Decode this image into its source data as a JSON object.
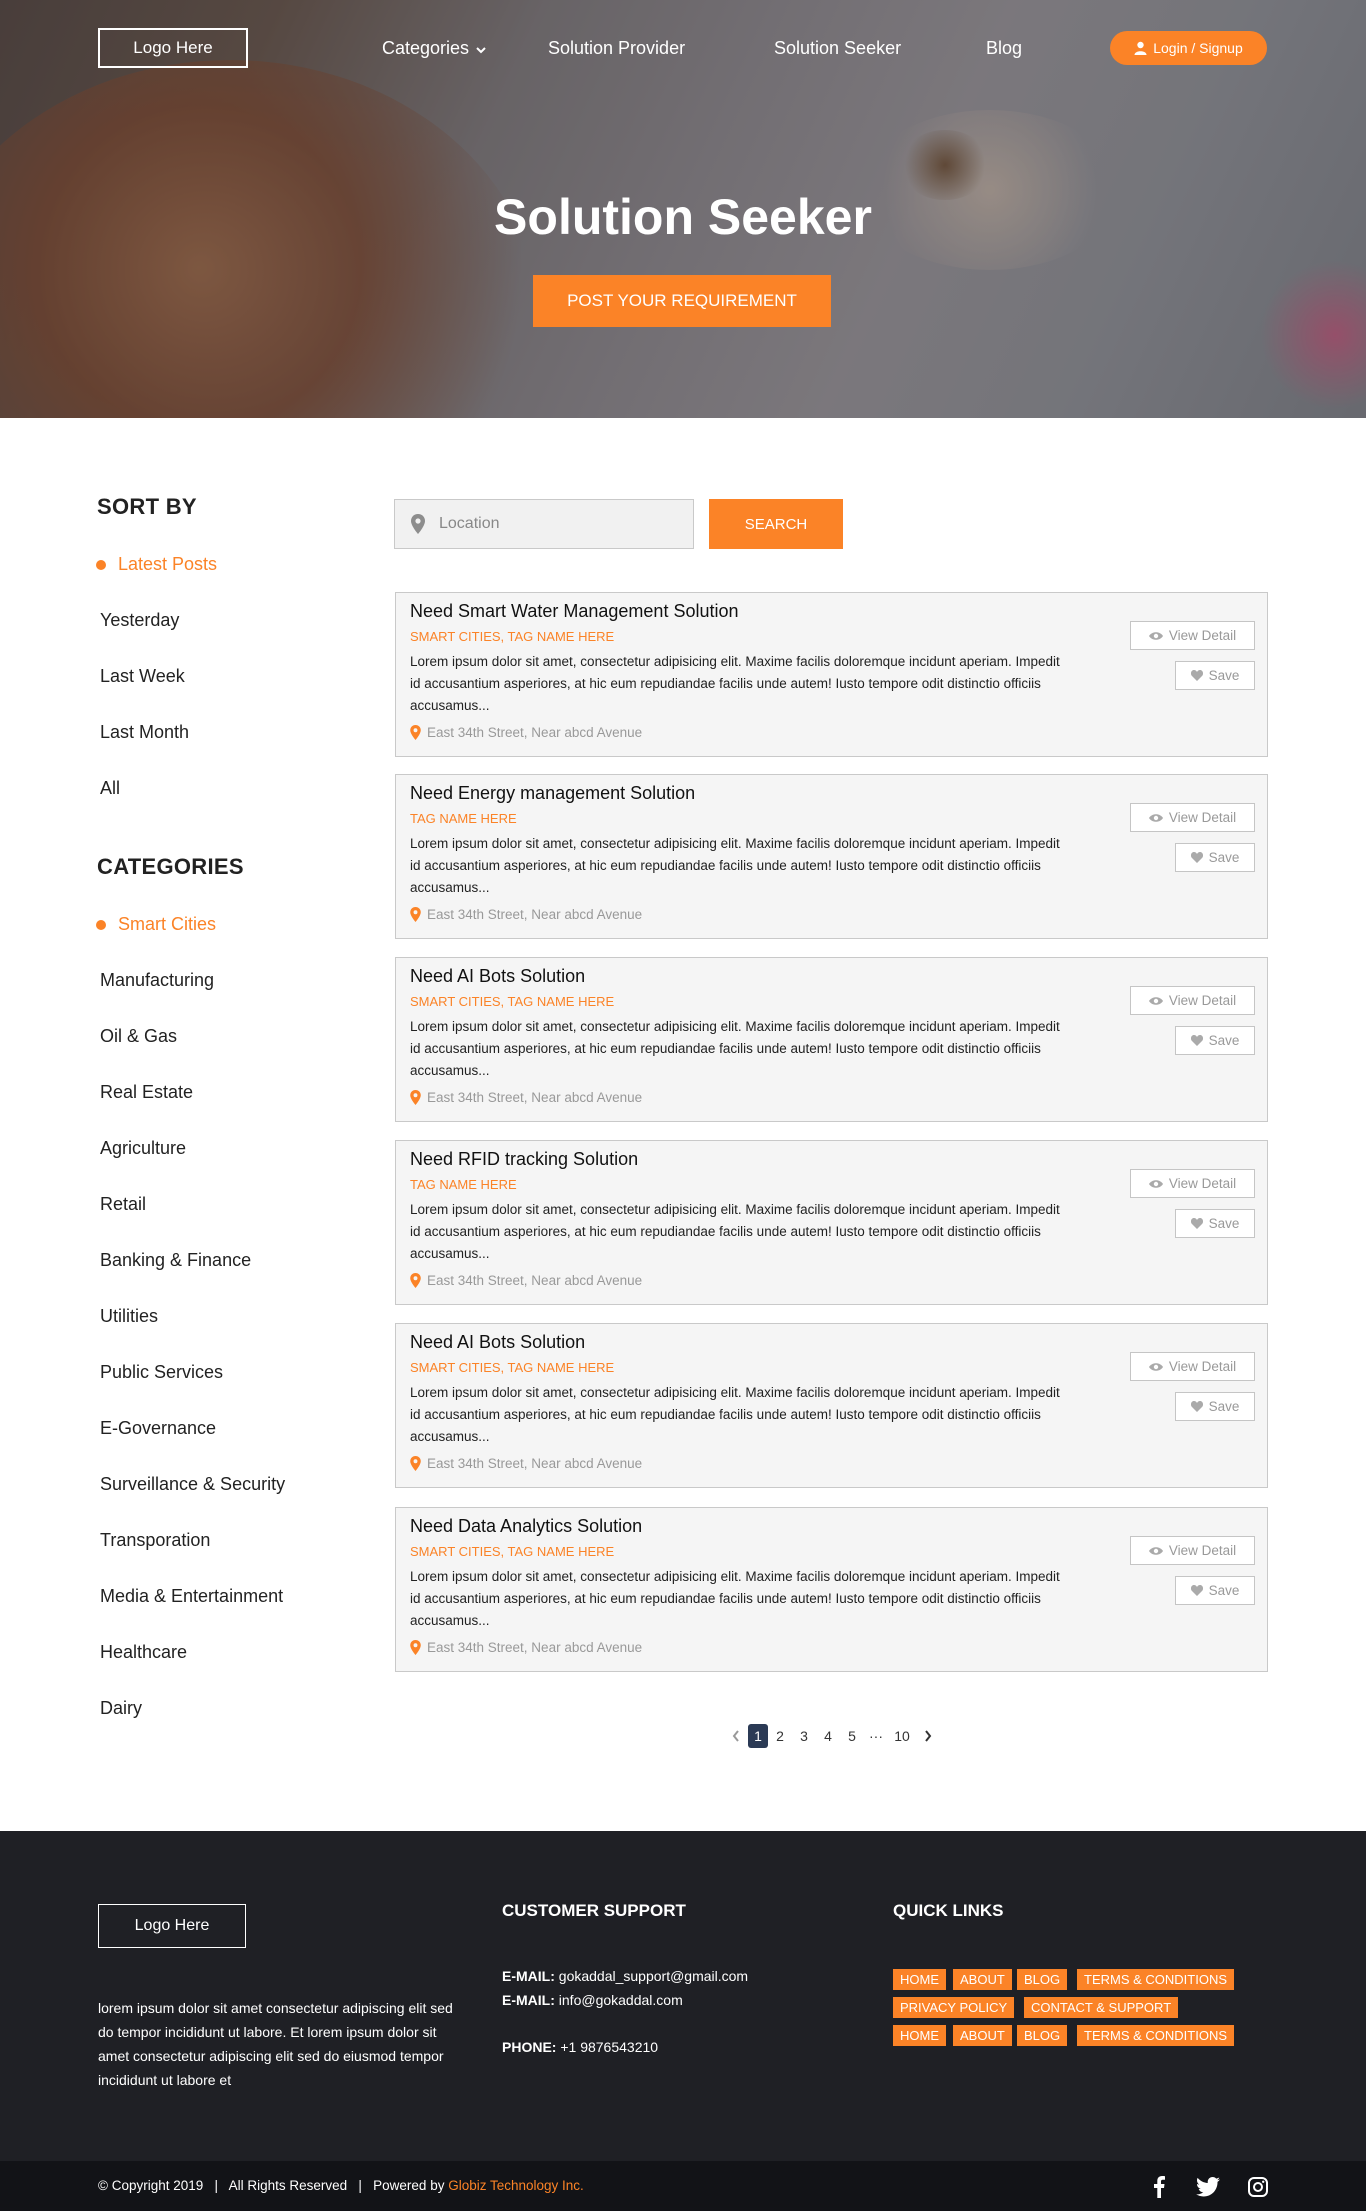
{
  "nav": {
    "logo": "Logo Here",
    "links": [
      "Categories",
      "Solution Provider",
      "Solution Seeker",
      "Blog"
    ],
    "login": "Login / Signup"
  },
  "hero": {
    "title": "Solution Seeker",
    "cta": "POST YOUR REQUIREMENT"
  },
  "sort": {
    "heading": "SORT BY",
    "items": [
      "Latest Posts",
      "Yesterday",
      "Last Week",
      "Last Month",
      "All"
    ]
  },
  "categories": {
    "heading": "CATEGORIES",
    "items": [
      "Smart Cities",
      "Manufacturing",
      "Oil & Gas",
      "Real Estate",
      "Agriculture",
      "Retail",
      "Banking & Finance",
      "Utilities",
      "Public Services",
      "E-Governance",
      "Surveillance & Security",
      "Transporation",
      "Media & Entertainment",
      "Healthcare",
      "Dairy"
    ]
  },
  "search": {
    "placeholder": "Location",
    "button": "SEARCH"
  },
  "listings": [
    {
      "title": "Need Smart Water Management Solution",
      "tags": "SMART CITIES, TAG NAME HERE",
      "desc": "Lorem ipsum dolor sit amet, consectetur adipisicing elit. Maxime facilis doloremque incidunt aperiam. Impedit id accusantium asperiores, at hic eum repudiandae facilis unde autem! Iusto tempore odit distinctio officiis accusamus...",
      "location": "East 34th Street, Near abcd Avenue"
    },
    {
      "title": "Need Energy management Solution",
      "tags": "TAG NAME HERE",
      "desc": "Lorem ipsum dolor sit amet, consectetur adipisicing elit. Maxime facilis doloremque incidunt aperiam. Impedit id accusantium asperiores, at hic eum repudiandae facilis unde autem! Iusto tempore odit distinctio officiis accusamus...",
      "location": "East 34th Street, Near abcd Avenue"
    },
    {
      "title": "Need AI Bots Solution",
      "tags": "SMART CITIES, TAG NAME HERE",
      "desc": "Lorem ipsum dolor sit amet, consectetur adipisicing elit. Maxime facilis doloremque incidunt aperiam. Impedit id accusantium asperiores, at hic eum repudiandae facilis unde autem! Iusto tempore odit distinctio officiis accusamus...",
      "location": "East 34th Street, Near abcd Avenue"
    },
    {
      "title": "Need RFID tracking Solution",
      "tags": "TAG NAME HERE",
      "desc": "Lorem ipsum dolor sit amet, consectetur adipisicing elit. Maxime facilis doloremque incidunt aperiam. Impedit id accusantium asperiores, at hic eum repudiandae facilis unde autem! Iusto tempore odit distinctio officiis accusamus...",
      "location": "East 34th Street, Near abcd Avenue"
    },
    {
      "title": "Need AI Bots Solution",
      "tags": "SMART CITIES, TAG NAME HERE",
      "desc": "Lorem ipsum dolor sit amet, consectetur adipisicing elit. Maxime facilis doloremque incidunt aperiam. Impedit id accusantium asperiores, at hic eum repudiandae facilis unde autem! Iusto tempore odit distinctio officiis accusamus...",
      "location": "East 34th Street, Near abcd Avenue"
    },
    {
      "title": "Need Data Analytics Solution",
      "tags": "SMART CITIES, TAG NAME HERE",
      "desc": "Lorem ipsum dolor sit amet, consectetur adipisicing elit. Maxime facilis doloremque incidunt aperiam. Impedit id accusantium asperiores, at hic eum repudiandae facilis unde autem! Iusto tempore odit distinctio officiis accusamus...",
      "location": "East 34th Street, Near abcd Avenue"
    }
  ],
  "listing_buttons": {
    "view": "View Detail",
    "save": "Save"
  },
  "pagination": {
    "pages": [
      "1",
      "2",
      "3",
      "4",
      "5",
      "···",
      "10"
    ],
    "current": "1"
  },
  "footer": {
    "logo": "Logo Here",
    "about": "lorem ipsum dolor sit amet consectetur adipiscing elit sed do tempor incididunt ut labore.  Et lorem ipsum dolor sit amet consectetur adipiscing elit sed do eiusmod tempor incididunt ut labore et",
    "support_heading": "CUSTOMER SUPPORT",
    "email_label": "E-MAIL:",
    "email1": "gokaddal_support@gmail.com",
    "email2": "info@gokaddal.com",
    "phone_label": "PHONE:",
    "phone": "+1 9876543210",
    "links_heading": "QUICK LINKS",
    "quick_links": [
      "HOME",
      "ABOUT",
      "BLOG",
      "TERMS & CONDITIONS",
      "PRIVACY POLICY",
      "CONTACT & SUPPORT",
      "HOME",
      "ABOUT",
      "BLOG",
      "TERMS & CONDITIONS"
    ]
  },
  "bottom": {
    "copyright": "© Copyright 2019",
    "rights": "All Rights Reserved",
    "powered_label": "Powered by",
    "powered_brand": "Globiz Technology Inc.",
    "social": [
      "facebook-icon",
      "twitter-icon",
      "instagram-icon"
    ]
  },
  "colors": {
    "accent": "#fb8327",
    "footer_bg": "#1f2025",
    "bottom_bg": "#121317"
  }
}
